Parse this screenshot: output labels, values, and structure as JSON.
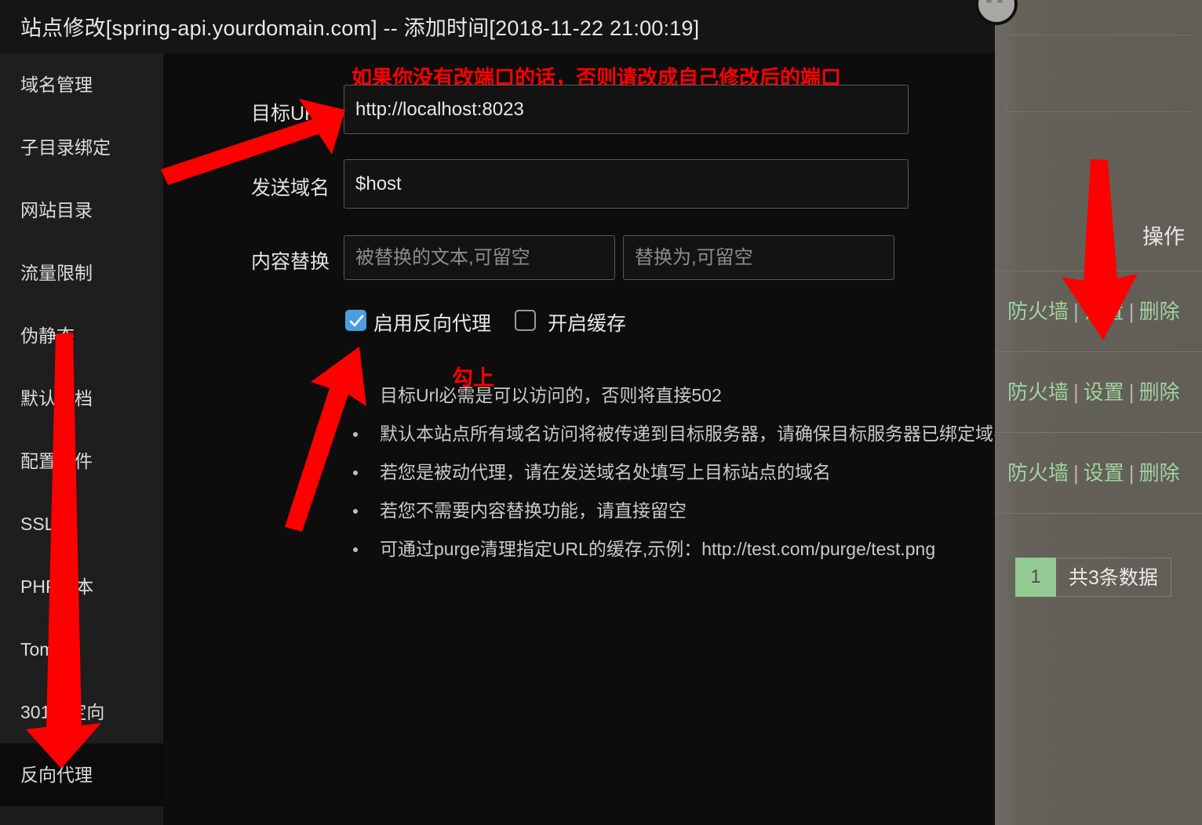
{
  "window": {
    "title": "站点修改[spring-api.yourdomain.com] -- 添加时间[2018-11-22 21:00:19]"
  },
  "sidebar": {
    "items": [
      {
        "label": "域名管理",
        "active": false
      },
      {
        "label": "子目录绑定",
        "active": false
      },
      {
        "label": "网站目录",
        "active": false
      },
      {
        "label": "流量限制",
        "active": false
      },
      {
        "label": "伪静态",
        "active": false
      },
      {
        "label": "默认文档",
        "active": false
      },
      {
        "label": "配置文件",
        "active": false
      },
      {
        "label": "SSL",
        "active": false
      },
      {
        "label": "PHP版本",
        "active": false
      },
      {
        "label": "Tomcat",
        "active": false
      },
      {
        "label": "301重定向",
        "active": false
      },
      {
        "label": "反向代理",
        "active": true
      }
    ]
  },
  "annotations": {
    "port_hint": "如果你没有改端口的话，否则请改成自己修改后的端口",
    "check_hint": "勾上",
    "arrow_color": "#fe0000"
  },
  "form": {
    "target_url": {
      "label": "目标URL",
      "value": "http://localhost:8023",
      "placeholder": ""
    },
    "send_host": {
      "label": "发送域名",
      "value": "$host",
      "placeholder": ""
    },
    "content_replace": {
      "label": "内容替换",
      "from_value": "",
      "from_placeholder": "被替换的文本,可留空",
      "to_value": "",
      "to_placeholder": "替换为,可留空"
    },
    "checkboxes": [
      {
        "label": "启用反向代理",
        "checked": true
      },
      {
        "label": "开启缓存",
        "checked": false
      }
    ]
  },
  "notes": [
    "目标Url必需是可以访问的，否则将直接502",
    "默认本站点所有域名访问将被传递到目标服务器，请确保目标服务器已绑定域名",
    "若您是被动代理，请在发送域名处填写上目标站点的域名",
    "若您不需要内容替换功能，请直接留空",
    "可通过purge清理指定URL的缓存,示例：http://test.com/purge/test.png"
  ],
  "right_panel": {
    "header": "操作",
    "link_color": "#9fd39f",
    "rows": [
      {
        "firewall": "防火墙",
        "settings": "设置",
        "delete": "删除"
      },
      {
        "firewall": "防火墙",
        "settings": "设置",
        "delete": "删除"
      },
      {
        "firewall": "防火墙",
        "settings": "设置",
        "delete": "删除"
      }
    ],
    "pagination": {
      "current_page": "1",
      "total_text": "共3条数据"
    }
  }
}
